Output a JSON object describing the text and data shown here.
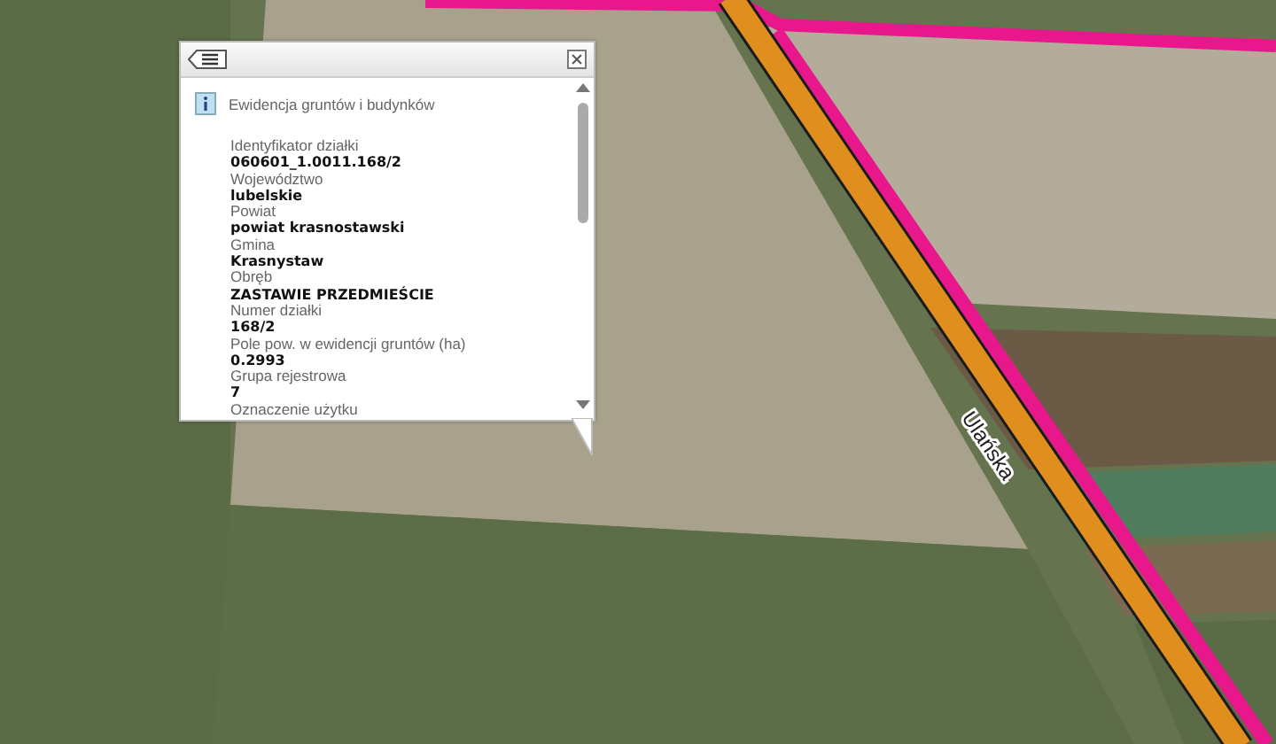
{
  "map": {
    "road_label": "Ulańska"
  },
  "popup": {
    "title": "Ewidencja gruntów i budynków",
    "fields": [
      {
        "label": "Identyfikator działki",
        "value": "060601_1.0011.168/2"
      },
      {
        "label": "Województwo",
        "value": "lubelskie"
      },
      {
        "label": "Powiat",
        "value": "powiat krasnostawski"
      },
      {
        "label": "Gmina",
        "value": "Krasnystaw"
      },
      {
        "label": "Obręb",
        "value": "ZASTAWIE PRZEDMIEŚCIE"
      },
      {
        "label": "Numer działki",
        "value": "168/2"
      },
      {
        "label": "Pole pow. w ewidencji gruntów (ha)",
        "value": "0.2993"
      },
      {
        "label": "Grupa rejestrowa",
        "value": "7"
      },
      {
        "label": "Oznaczenie użytku"
      }
    ]
  }
}
